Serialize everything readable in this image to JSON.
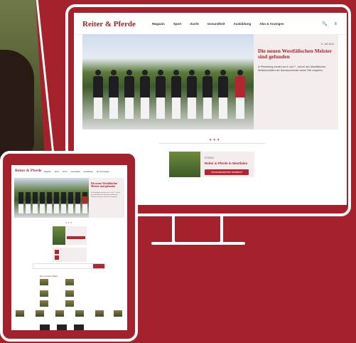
{
  "desktop": {
    "logo": "Reiter & Pferde",
    "nav": [
      "Magazin",
      "Sport",
      "Zucht",
      "Gesundheit",
      "Ausbildung",
      "Abo & Anzeigen"
    ],
    "header_icons": "🔍 ≡",
    "hero": {
      "date": "6. Juli 2024",
      "title": "Die neuen Westfälischen Meister sind gefunden",
      "text": "In Pferdeberg wurden am 6. und 7. Juli bei den Westfälischen Meisterschaften der Nachwuchsreiter sechs Titel vergeben."
    },
    "divider_icons": "✦ ✦ ✦",
    "promo": {
      "date": "07/2024",
      "title": "Reiter & Pferde in Westfalen",
      "button": "Versandkostenfrei bestellen!"
    }
  },
  "tablet": {
    "logo": "Reiter & Pferde",
    "nav": [
      "Magazin",
      "Sport",
      "Zucht",
      "Gesundheit",
      "Ausbildung",
      "Abo & Anzeigen"
    ],
    "hero": {
      "title": "Die neuen Westfälischen Meister sind gefunden",
      "text": "In Pferdeberg wurden am 6. und 7. Juli bei den Westfälischen Meisterschaften der Nachwuchsreiter sechs Titel vergeben."
    },
    "divider_icons": "✦ ✦ ✦",
    "section_heading": "Die neusten Artikel"
  },
  "colors": {
    "brand": "#a3222b",
    "panel": "#f4eded"
  }
}
